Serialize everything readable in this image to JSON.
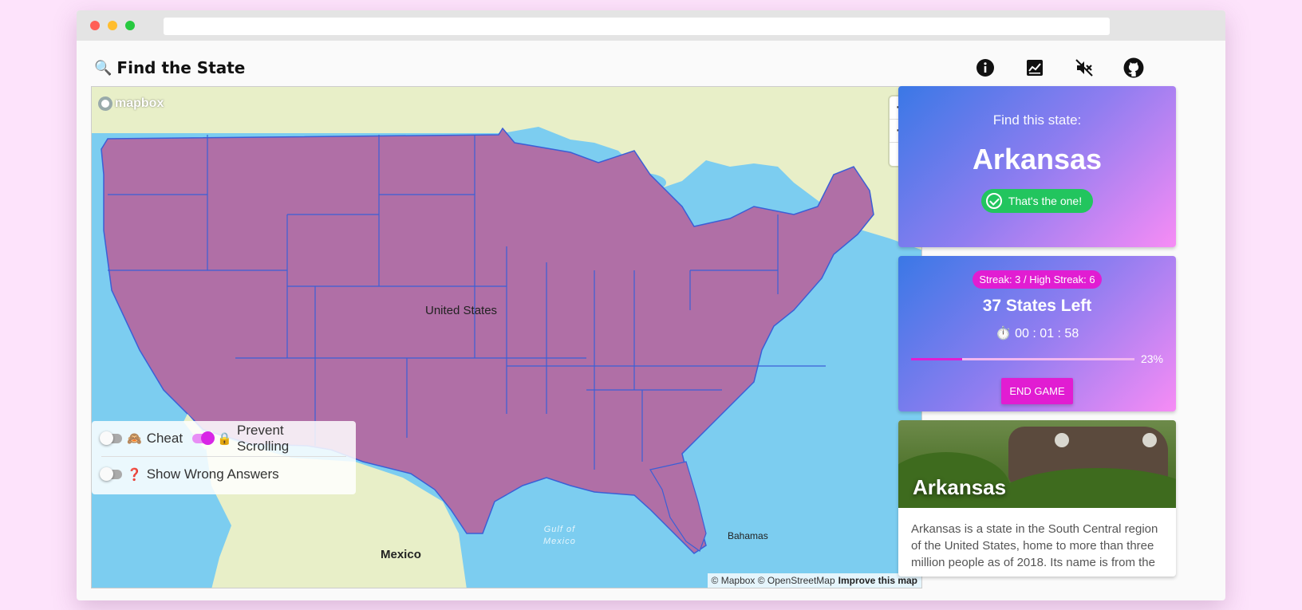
{
  "header": {
    "search_glyph": "🔍",
    "title": "Find the State",
    "icons": [
      "info-icon",
      "chart-icon",
      "mute-icon",
      "github-icon"
    ]
  },
  "map": {
    "logo": "mapbox",
    "zoom_in": "+",
    "zoom_out": "−",
    "compass": "▲",
    "label_country": "United States",
    "label_mexico": "Mexico",
    "label_gulf": "Gulf of\nMexico",
    "label_bahamas": "Bahamas",
    "attribution": "© Mapbox © OpenStreetMap",
    "improve": "Improve this map",
    "colors": {
      "water": "#7ccdf0",
      "land": "#e8efc8",
      "states": "#b06fa6",
      "border": "#3b5fd6"
    }
  },
  "controls": {
    "cheat": {
      "emoji": "🙈",
      "label": "Cheat",
      "on": false
    },
    "prevent_scrolling": {
      "emoji": "🔒",
      "label": "Prevent Scrolling",
      "on": true
    },
    "show_wrong": {
      "emoji": "❓",
      "label": "Show Wrong Answers",
      "on": false
    }
  },
  "target": {
    "prompt": "Find this state:",
    "state": "Arkansas",
    "feedback": "That's the one!"
  },
  "stats": {
    "streak": "Streak: 3 / High Streak: 6",
    "states_left": "37 States Left",
    "timer_glyph": "⏱️",
    "timer": "00 : 01 : 58",
    "progress": 0.23,
    "progress_label": "23%",
    "end_game": "END GAME"
  },
  "info": {
    "title": "Arkansas",
    "description": "Arkansas is a state in the South Central region of the United States, home to more than three million people as of 2018. Its name is from the"
  }
}
